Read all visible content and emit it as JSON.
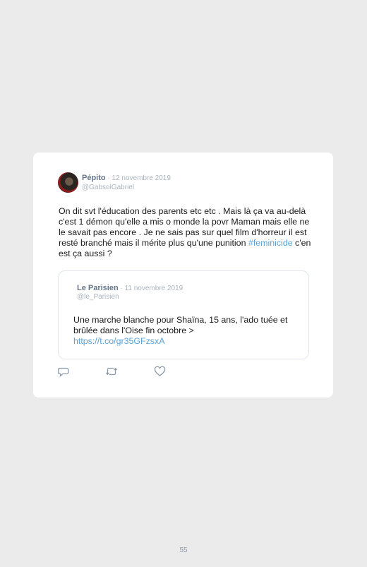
{
  "tweet": {
    "author_name": "Pépito",
    "date": " · 12 novembre 2019",
    "handle": "@GabsolGabriel",
    "text_before": "On dit svt l'éducation des parents etc etc . Mais là ça va au-delà c'est 1 démon qu'elle a mis o monde la povr Maman mais elle ne le savait pas encore . Je ne sais pas sur quel film d'horreur il est resté branché mais il mérite plus qu'une punition ",
    "hashtag": "#feminicide",
    "text_after": " c'en est ça aussi ?"
  },
  "quoted": {
    "author_name": "Le Parisien",
    "date": " · 11 novembre 2019",
    "handle": "@le_Parisien",
    "text": "Une marche blanche pour Shaïna, 15 ans, l'ado tuée et brûlée dans l'Oise fin octobre >",
    "link": "https://t.co/gr35GFzsxA"
  },
  "actions": [
    "reply-icon",
    "retweet-icon",
    "like-icon"
  ],
  "colors": {
    "link": "#5aa3d8",
    "name": "#66758a",
    "muted": "#aab4c0",
    "background": "#ebebeb"
  },
  "page_number": "55"
}
